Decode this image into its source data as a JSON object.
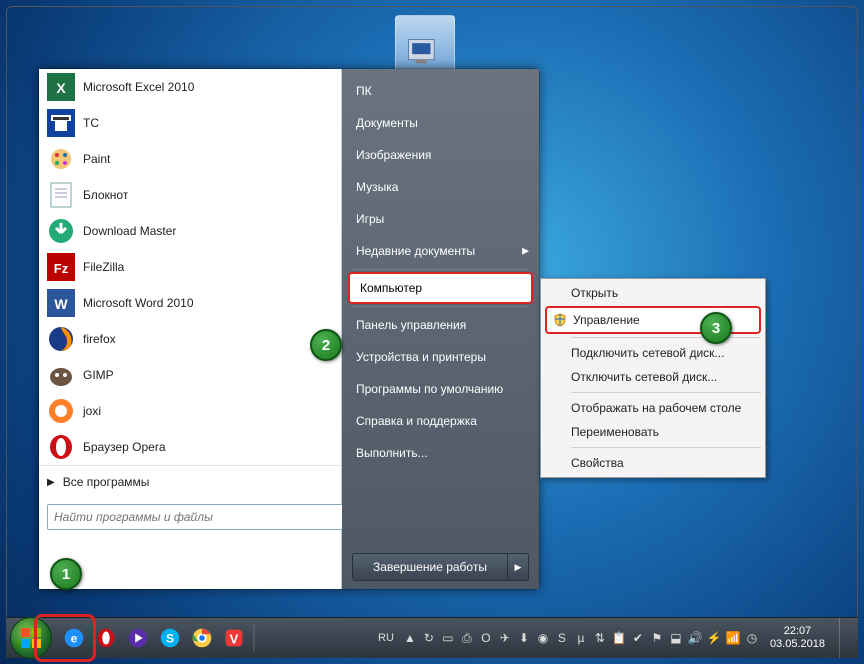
{
  "programs": [
    {
      "label": "Microsoft Excel 2010",
      "icon": "excel"
    },
    {
      "label": "TC",
      "icon": "tc"
    },
    {
      "label": "Paint",
      "icon": "paint"
    },
    {
      "label": "Блокнот",
      "icon": "notepad"
    },
    {
      "label": "Download Master",
      "icon": "dm"
    },
    {
      "label": "FileZilla",
      "icon": "filezilla"
    },
    {
      "label": "Microsoft Word 2010",
      "icon": "word"
    },
    {
      "label": "firefox",
      "icon": "firefox"
    },
    {
      "label": "GIMP",
      "icon": "gimp"
    },
    {
      "label": "joxi",
      "icon": "joxi"
    },
    {
      "label": "Браузер Opera",
      "icon": "opera"
    }
  ],
  "all_programs_label": "Все программы",
  "search_placeholder": "Найти программы и файлы",
  "right_items": [
    {
      "label": "ПК"
    },
    {
      "label": "Документы"
    },
    {
      "label": "Изображения"
    },
    {
      "label": "Музыка"
    },
    {
      "label": "Игры"
    },
    {
      "label": "Недавние документы",
      "chev": true
    },
    {
      "label": "Компьютер",
      "selected": true
    },
    {
      "label": "Панель управления"
    },
    {
      "label": "Устройства и принтеры"
    },
    {
      "label": "Программы по умолчанию"
    },
    {
      "label": "Справка и поддержка"
    },
    {
      "label": "Выполнить..."
    }
  ],
  "shutdown_label": "Завершение работы",
  "context_menu": [
    {
      "label": "Открыть"
    },
    {
      "label": "Управление",
      "selected": true,
      "shield": true
    },
    {
      "sep": true
    },
    {
      "label": "Подключить сетевой диск..."
    },
    {
      "label": "Отключить сетевой диск..."
    },
    {
      "sep": true
    },
    {
      "label": "Отображать на рабочем столе"
    },
    {
      "label": "Переименовать"
    },
    {
      "sep": true
    },
    {
      "label": "Свойства"
    }
  ],
  "taskbar_pinned": [
    "ie",
    "opera",
    "wmp",
    "skype",
    "chrome",
    "vivaldi"
  ],
  "tray_lang": "RU",
  "tray_icons": [
    "up",
    "sync",
    "display",
    "printer",
    "opera",
    "telegram",
    "download",
    "eye",
    "skype",
    "utorrent",
    "network",
    "clipboard",
    "av",
    "flag",
    "dropbox",
    "speaker",
    "power",
    "wifi",
    "clock-ic"
  ],
  "clock_time": "22:07",
  "clock_date": "03.05.2018",
  "badges": {
    "1": "1",
    "2": "2",
    "3": "3"
  }
}
